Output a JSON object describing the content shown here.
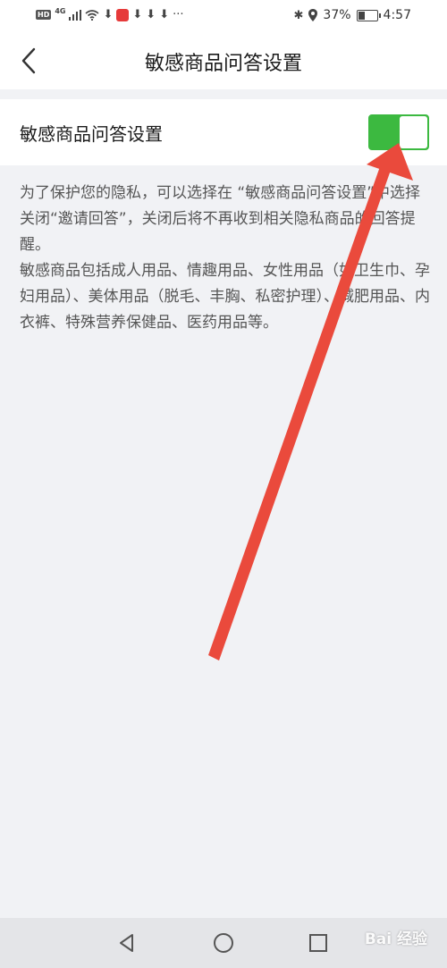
{
  "status_bar": {
    "left_icons": [
      "hd-icon",
      "4g-signal-icon",
      "wifi-icon",
      "download-icon",
      "app-icon",
      "download-icon",
      "download-icon",
      "download-icon",
      "more-dots-icon"
    ],
    "hd": "HD",
    "network": "4G",
    "battery_percent": "37%",
    "battery_level": 0.37,
    "time": "4:57"
  },
  "header": {
    "title": "敏感商品问答设置"
  },
  "setting": {
    "label": "敏感商品问答设置",
    "toggle_on": true,
    "toggle_color": "#3cb940"
  },
  "description": {
    "paragraph1": "为了保护您的隐私，可以选择在 “敏感商品问答设置”中选择关闭“邀请回答”，关闭后将不再收到相关隐私商品的回答提醒。",
    "paragraph2": "敏感商品包括成人用品、情趣用品、女性用品（如卫生巾、孕妇用品）、美体用品（脱毛、丰胸、私密护理）、减肥用品、内衣裤、特殊营养保健品、医药用品等。"
  },
  "annotation": {
    "arrow_color": "#ea4a3c"
  },
  "system_nav": {
    "icons": [
      "back-triangle-icon",
      "home-circle-icon",
      "recent-square-icon"
    ]
  },
  "watermark": {
    "text": "Bai 经验"
  }
}
